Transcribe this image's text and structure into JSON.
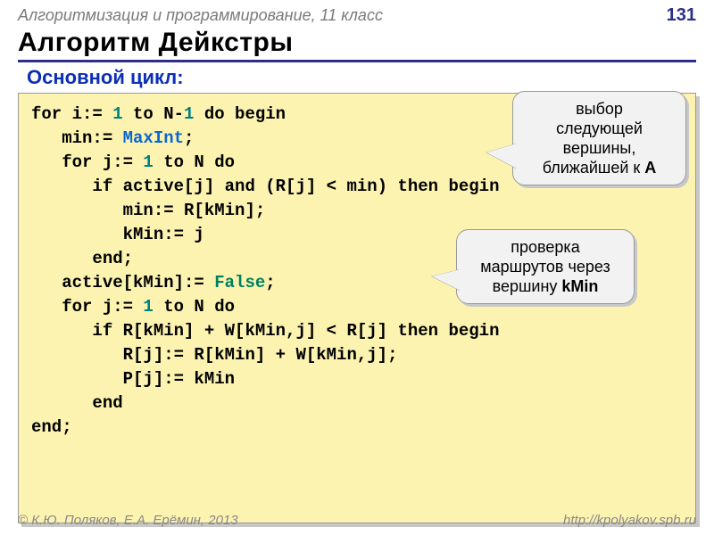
{
  "header": {
    "course": "Алгоритмизация и программирование, 11 класс",
    "page": "131"
  },
  "title": "Алгоритм Дейкстры",
  "section_label": "Основной цикл:",
  "code_tokens": [
    [
      [
        "kw",
        "for i:= "
      ],
      [
        "num",
        "1"
      ],
      [
        "kw",
        " to N"
      ],
      [
        "kw",
        "-"
      ],
      [
        "num",
        "1"
      ],
      [
        "kw",
        " do begin"
      ]
    ],
    [
      [
        "kw",
        "   min:= "
      ],
      [
        "id",
        "MaxInt"
      ],
      [
        "kw",
        ";"
      ]
    ],
    [
      [
        "kw",
        "   for j:= "
      ],
      [
        "num",
        "1"
      ],
      [
        "kw",
        " to N do"
      ]
    ],
    [
      [
        "kw",
        "      if active[j] and (R[j] < min) then begin"
      ]
    ],
    [
      [
        "kw",
        "         min:= R[kMin];"
      ]
    ],
    [
      [
        "kw",
        "         kMin:= j"
      ]
    ],
    [
      [
        "kw",
        "      end;"
      ]
    ],
    [
      [
        "kw",
        "   active[kMin]:= "
      ],
      [
        "bool",
        "False"
      ],
      [
        "kw",
        ";"
      ]
    ],
    [
      [
        "kw",
        "   for j:= "
      ],
      [
        "num",
        "1"
      ],
      [
        "kw",
        " to N do"
      ]
    ],
    [
      [
        "kw",
        "      if R[kMin] + W[kMin,j] < R[j] then begin"
      ]
    ],
    [
      [
        "kw",
        "         R[j]:= R[kMin] + W[kMin,j];"
      ]
    ],
    [
      [
        "kw",
        "         P[j]:= kMin"
      ]
    ],
    [
      [
        "kw",
        "      end"
      ]
    ],
    [
      [
        "kw",
        "end;"
      ]
    ]
  ],
  "callouts": {
    "c1_l1": "выбор",
    "c1_l2": "следующей",
    "c1_l3": "вершины,",
    "c1_l4a": "ближайшей к ",
    "c1_l4b": "A",
    "c2_l1": "проверка",
    "c2_l2": "маршрутов через",
    "c2_l3a": "вершину ",
    "c2_l3b": "kMin"
  },
  "footer": {
    "authors": "© К.Ю. Поляков, Е.А. Ерёмин, 2013",
    "url": "http://kpolyakov.spb.ru"
  }
}
